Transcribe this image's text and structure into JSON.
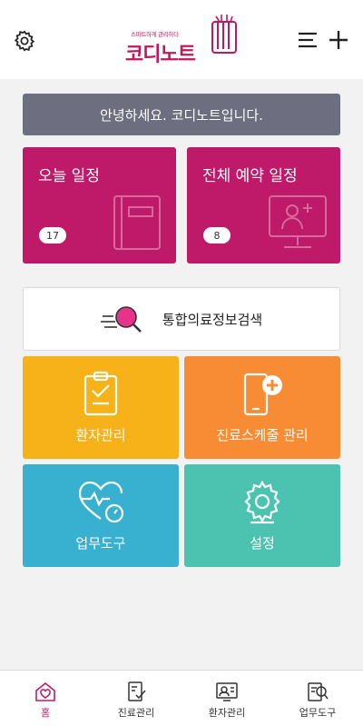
{
  "header": {
    "logo_tagline": "스마트하게 관리하다",
    "logo_text": "코디노트",
    "settings_icon": "gear-icon",
    "menu_icon": "menu-icon",
    "add_icon": "plus-icon"
  },
  "greeting": "안녕하세요. 코디노트입니다.",
  "schedule_cards": [
    {
      "title": "오늘 일정",
      "count": "17",
      "icon": "notebook-icon"
    },
    {
      "title": "전체 예약 일정",
      "count": "8",
      "icon": "monitor-users-icon"
    }
  ],
  "search": {
    "label": "통합의료정보검색",
    "icon": "search-magnifier-icon"
  },
  "tiles": [
    {
      "label": "환자관리",
      "icon": "clipboard-check-icon",
      "color": "#f7b21a"
    },
    {
      "label": "진료스케줄 관리",
      "icon": "phone-plus-icon",
      "color": "#f78c35"
    },
    {
      "label": "업무도구",
      "icon": "heartbeat-icon",
      "color": "#38b1d0"
    },
    {
      "label": "설정",
      "icon": "gear-icon",
      "color": "#4cc3b0"
    }
  ],
  "bottom_nav": [
    {
      "label": "홈",
      "icon": "home-heart-icon",
      "active": true
    },
    {
      "label": "진료관리",
      "icon": "document-check-icon",
      "active": false
    },
    {
      "label": "환자관리",
      "icon": "patient-card-icon",
      "active": false
    },
    {
      "label": "업무도구",
      "icon": "document-search-icon",
      "active": false
    }
  ],
  "colors": {
    "brand": "#bf1a6a",
    "greeting_bg": "#6d6e80",
    "background": "#f2f2f2"
  }
}
